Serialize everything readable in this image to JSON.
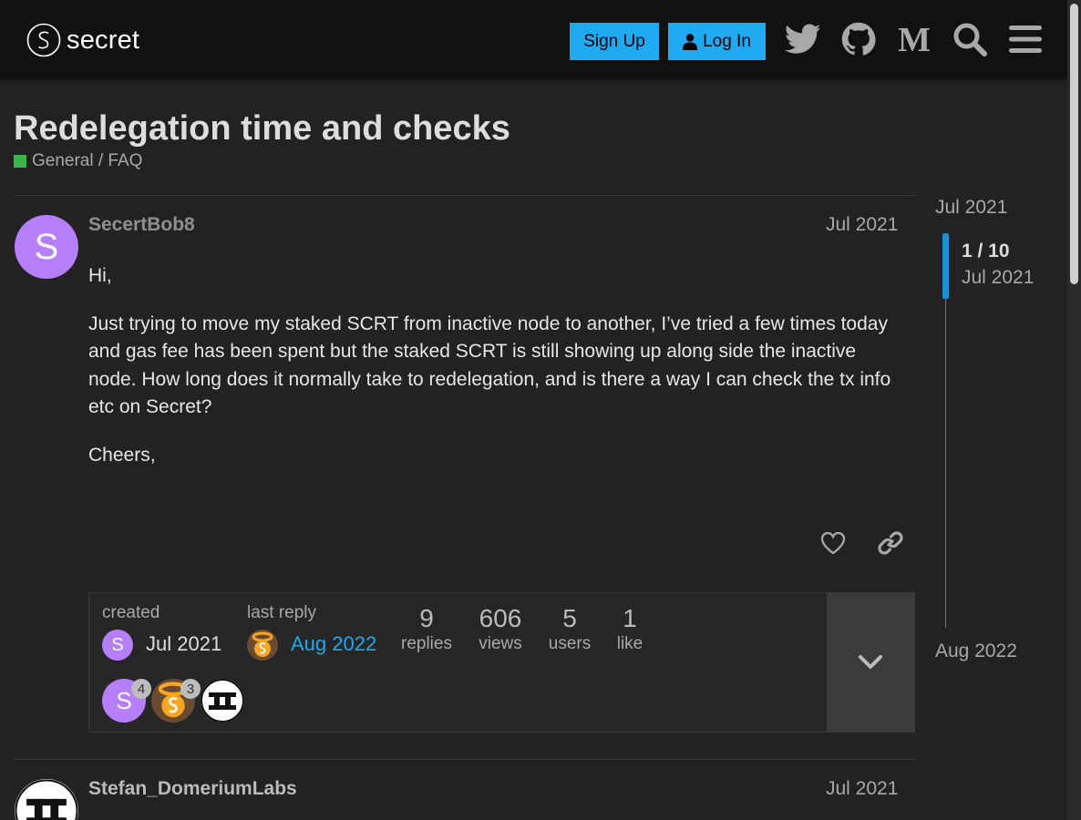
{
  "header": {
    "logo_text": "secret",
    "signup_label": "Sign Up",
    "login_label": "Log In",
    "icons": [
      "twitter-icon",
      "github-icon",
      "medium-icon",
      "search-icon",
      "hamburger-menu-icon"
    ]
  },
  "topic": {
    "title": "Redelegation time and checks",
    "category": "General / FAQ",
    "category_color": "#3ab54a"
  },
  "posts": [
    {
      "username": "SecertBob8",
      "avatar_letter": "S",
      "avatar_color": "#b77ef9",
      "date": "Jul 2021",
      "paragraphs": [
        "Hi,",
        "Just trying to move my staked SCRT from inactive node to another, I’ve tried a few times today and gas fee has been spent but the staked SCRT is still showing up along side the inactive node. How long does it normally take to redelegation, and is there a way I can check the tx info etc on Secret?",
        "Cheers,"
      ]
    },
    {
      "username": "Stefan_DomeriumLabs",
      "date": "Jul 2021"
    }
  ],
  "topic_map": {
    "created_label": "created",
    "created_date": "Jul 2021",
    "last_reply_label": "last reply",
    "last_reply_date": "Aug 2022",
    "stats": [
      {
        "value": "9",
        "label": "replies"
      },
      {
        "value": "606",
        "label": "views"
      },
      {
        "value": "5",
        "label": "users"
      },
      {
        "value": "1",
        "label": "like"
      }
    ],
    "participants": [
      {
        "letter": "S",
        "count": "4"
      },
      {
        "count": "3"
      },
      {}
    ]
  },
  "timeline": {
    "start": "Jul 2021",
    "position": "1 / 10",
    "position_date": "Jul 2021",
    "end": "Aug 2022"
  },
  "colors": {
    "accent": "#1fa9f1",
    "timeline": "#1f8fd3",
    "last_reply": "#1fa9f1"
  }
}
